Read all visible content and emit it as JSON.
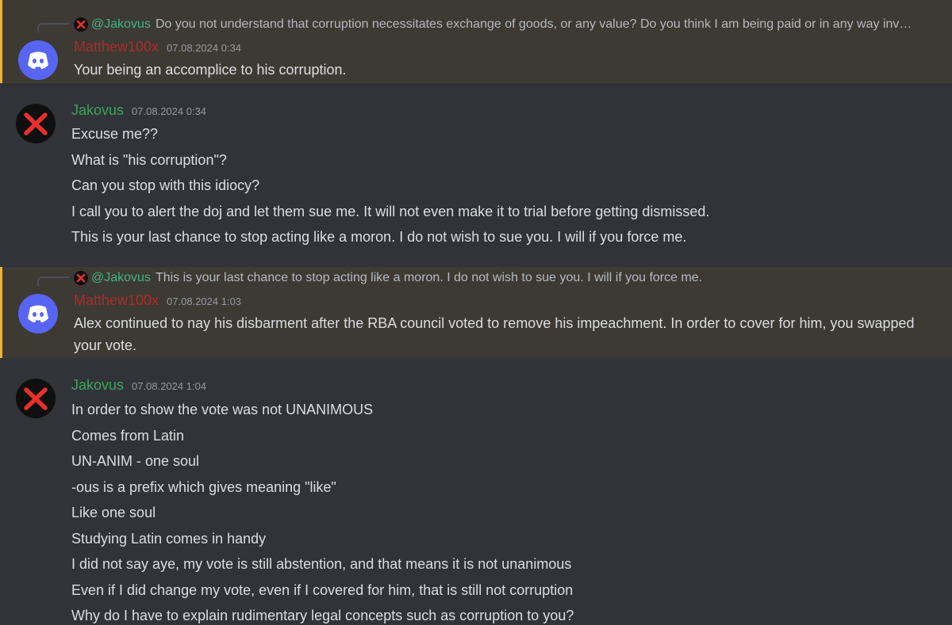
{
  "colors": {
    "background": "#313338",
    "mention_background": "#3c3a33",
    "mention_bar": "#f0b232",
    "username_matthew": "#ad2b2b",
    "username_jakovus": "#3ba55d",
    "discord_blurple": "#5865f2",
    "xmark_red": "#e8302c"
  },
  "messages": [
    {
      "reply": {
        "name": "@Jakovus",
        "text": "Do you not understand that corruption necessitates exchange of goods, or any value? Do you think I am being paid or in any way involved in his corruption?",
        "avatar_icon": "red-x-icon"
      },
      "author": "Matthew100x",
      "timestamp": "07.08.2024 0:34",
      "avatar_icon": "discord-logo-icon",
      "lines": [
        "Your being an accomplice to his corruption."
      ]
    },
    {
      "author": "Jakovus",
      "timestamp": "07.08.2024 0:34",
      "avatar_icon": "red-x-icon",
      "lines": [
        "Excuse me??",
        "What is \"his corruption\"?",
        "Can you stop with this idiocy?",
        "I call you to alert the doj and let them sue me. It will not even make it to trial before getting dismissed.",
        "This is your last chance to stop acting like a moron. I do not wish to sue you. I will if you force me."
      ]
    },
    {
      "reply": {
        "name": "@Jakovus",
        "text": "This is your last chance to stop acting like a moron. I do not wish to sue you. I will if you force me.",
        "avatar_icon": "red-x-icon"
      },
      "author": "Matthew100x",
      "timestamp": "07.08.2024 1:03",
      "avatar_icon": "discord-logo-icon",
      "lines": [
        "Alex continued to nay his disbarment after the RBA council voted to remove his impeachment. In order to cover for him, you swapped your vote."
      ]
    },
    {
      "author": "Jakovus",
      "timestamp": "07.08.2024 1:04",
      "avatar_icon": "red-x-icon",
      "lines": [
        "In order to show the vote was not UNANIMOUS",
        "Comes from Latin",
        "UN-ANIM - one soul",
        "-ous is a prefix which gives meaning \"like\"",
        "Like one soul",
        "Studying Latin comes in handy",
        "I did not say aye, my vote is still abstention, and that means it is not unanimous",
        "Even if I did change my vote, even if I covered for him, that is still not corruption",
        "Why do I have to explain rudimentary legal concepts such as corruption to you?"
      ]
    }
  ]
}
